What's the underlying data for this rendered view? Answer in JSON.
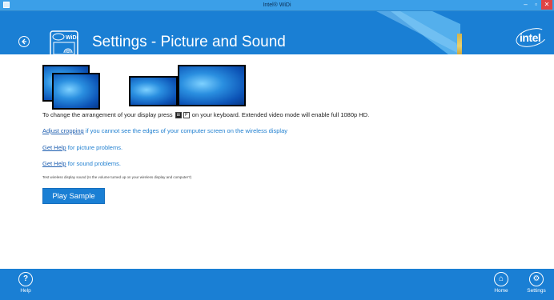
{
  "window": {
    "title": "Intel® WiDi",
    "minimize_icon": "minimize-icon",
    "maximize_icon": "maximize-icon",
    "close_icon": "close-icon"
  },
  "header": {
    "title": "Settings - Picture and Sound",
    "back_icon": "back-arrow-icon",
    "app_logo_text": "WiDi",
    "brand_logo": "intel",
    "accent_color": "#1a7fd4"
  },
  "content": {
    "arrangement_text_before": "To change the arrangement of your display press",
    "key_win": "⊞",
    "key_p": "P",
    "arrangement_text_after": "on your keyboard. Extended video mode will enable full 1080p HD.",
    "crop_link": "Adjust cropping",
    "crop_text": " if you cannot see the edges of your computer screen on the wireless display",
    "picture_link": "Get Help",
    "picture_text": " for picture problems.",
    "sound_link": "Get Help",
    "sound_text": " for sound problems.",
    "sound_note": "Test wireless display sound (Is the volume turned up on your wireless display and computer?)",
    "play_button": "Play Sample"
  },
  "bottom_bar": {
    "help_label": "Help",
    "home_label": "Home",
    "settings_label": "Settings"
  }
}
